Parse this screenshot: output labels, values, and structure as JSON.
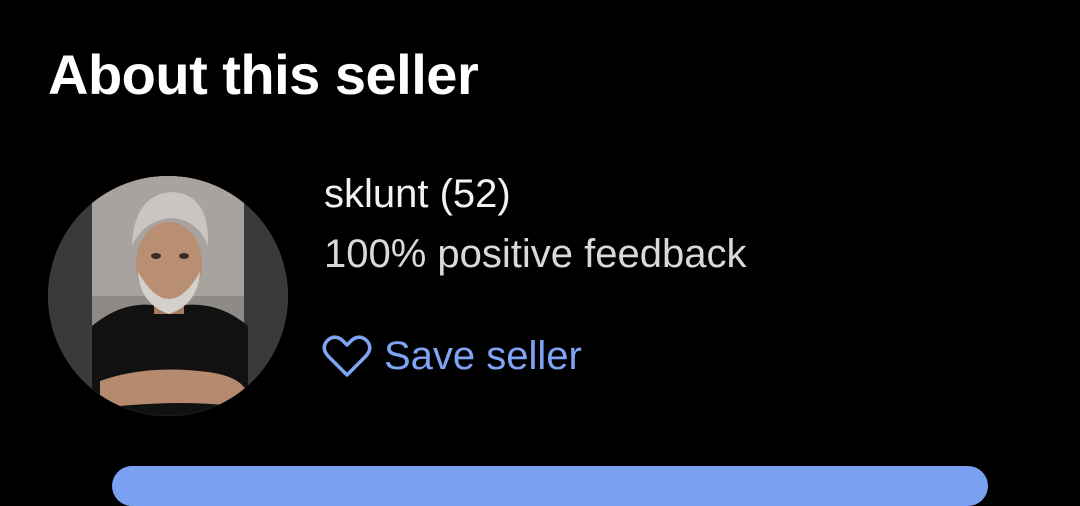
{
  "section": {
    "title": "About this seller"
  },
  "seller": {
    "avatar_icon": "seller-avatar-photo",
    "name": "sklunt (52)",
    "feedback": "100% positive feedback"
  },
  "actions": {
    "save_label": "Save seller",
    "save_icon": "heart-outline-icon",
    "accent_color": "#7fa4f4"
  }
}
